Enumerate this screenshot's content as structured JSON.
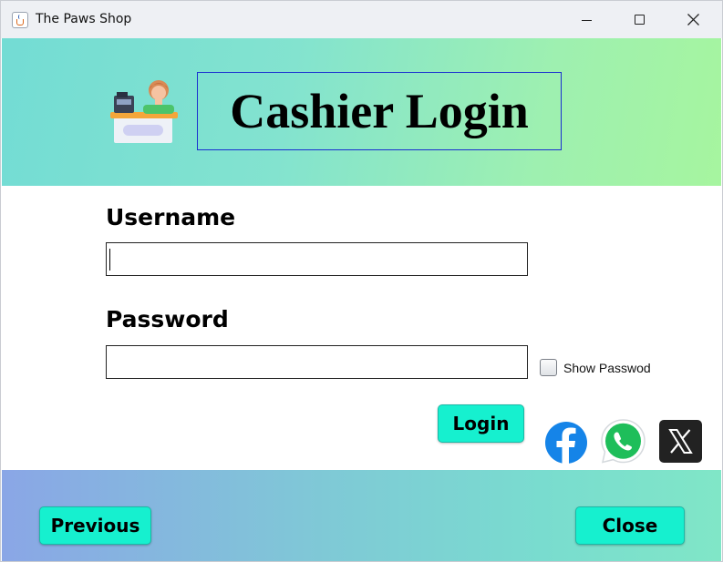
{
  "window": {
    "title": "The Paws Shop"
  },
  "header": {
    "title": "Cashier Login"
  },
  "form": {
    "username_label": "Username",
    "username_value": "",
    "password_label": "Password",
    "password_value": "",
    "show_password_label": "Show Passwod",
    "show_password_checked": false,
    "login_label": "Login"
  },
  "social": [
    "facebook-icon",
    "whatsapp-icon",
    "x-icon"
  ],
  "footer": {
    "previous_label": "Previous",
    "close_label": "Close"
  },
  "colors": {
    "button": "#16f0cf",
    "header_gradient": [
      "#73dcd4",
      "#a6f59f"
    ],
    "footer_gradient": [
      "#8aa6e6",
      "#80e6c7"
    ]
  }
}
